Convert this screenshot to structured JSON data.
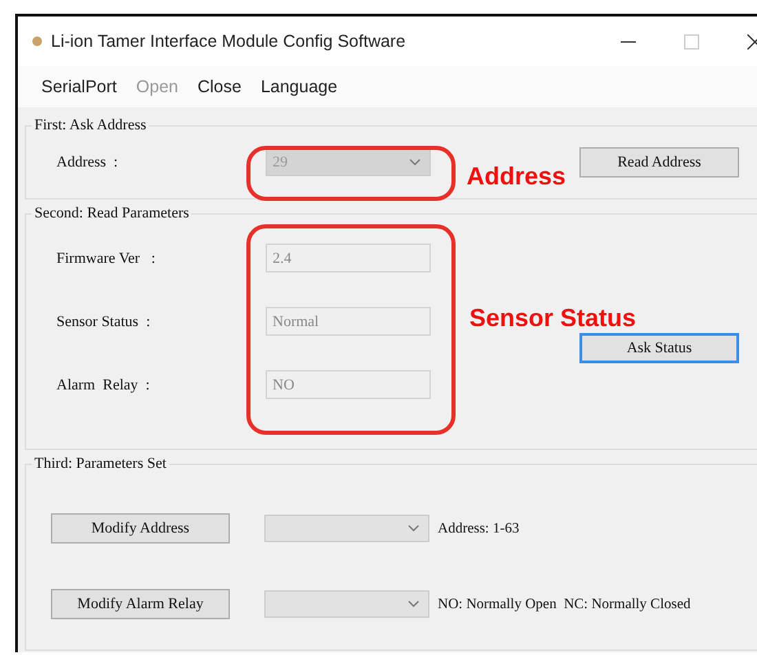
{
  "window": {
    "title": "Li-ion Tamer Interface Module Config Software"
  },
  "menu": [
    {
      "label": "SerialPort",
      "disabled": false
    },
    {
      "label": "Open",
      "disabled": true
    },
    {
      "label": "Close",
      "disabled": false
    },
    {
      "label": "Language",
      "disabled": false
    }
  ],
  "ask_address": {
    "title": "First: Ask Address",
    "label": "Address  :",
    "address": "29",
    "button": "Read Address"
  },
  "read_parameters": {
    "title": "Second: Read Parameters",
    "fields": [
      {
        "label": "Firmware Ver   :",
        "value": "2.4"
      },
      {
        "label": "Sensor Status  :",
        "value": "Normal"
      },
      {
        "label": "Alarm  Relay  :",
        "value": "NO"
      }
    ],
    "button": "Ask Status"
  },
  "parameters_set": {
    "title": "Third: Parameters Set",
    "rows": [
      {
        "button": "Modify Address",
        "hint": "Address: 1-63"
      },
      {
        "button": "Modify Alarm Relay",
        "hint": "NO: Normally Open  NC: Normally Closed"
      }
    ]
  },
  "annotations": [
    {
      "label": "Address"
    },
    {
      "label": "Sensor Status"
    }
  ]
}
